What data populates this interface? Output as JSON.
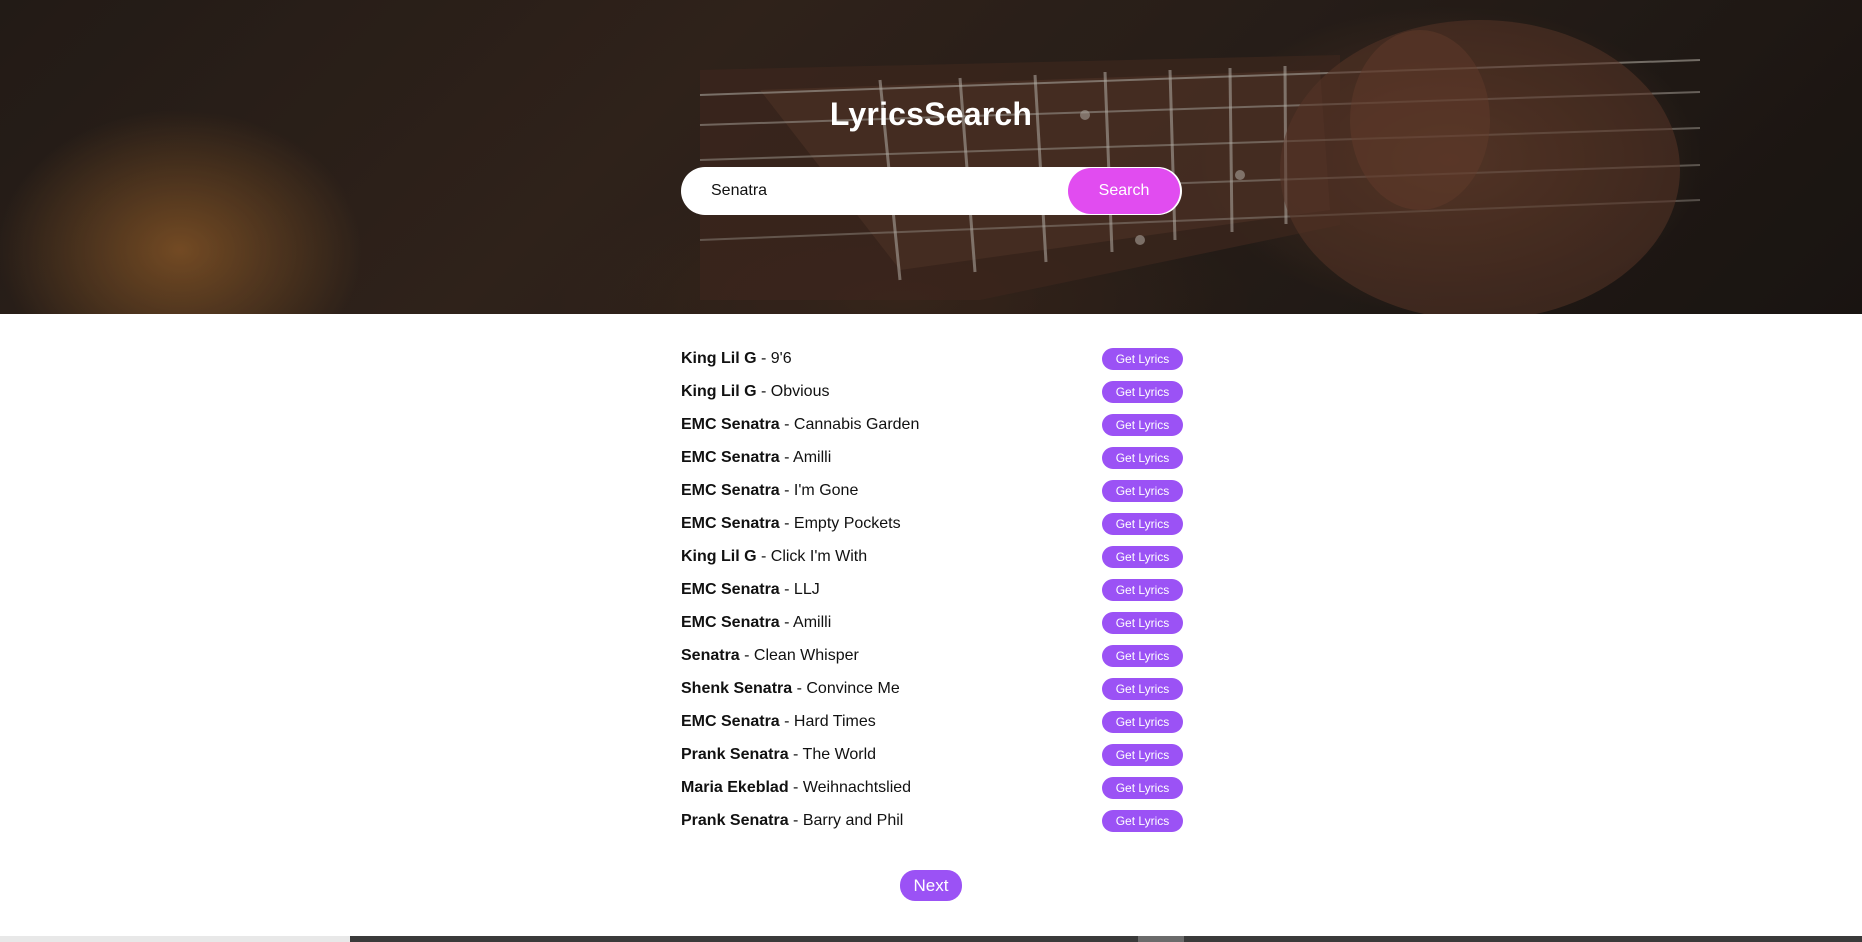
{
  "app": {
    "title": "LyricsSearch"
  },
  "search": {
    "value": "Senatra",
    "button_label": "Search"
  },
  "results": [
    {
      "artist": "King Lil G",
      "title": "9'6",
      "button_label": "Get Lyrics"
    },
    {
      "artist": "King Lil G",
      "title": "Obvious",
      "button_label": "Get Lyrics"
    },
    {
      "artist": "EMC Senatra",
      "title": "Cannabis Garden",
      "button_label": "Get Lyrics"
    },
    {
      "artist": "EMC Senatra",
      "title": "Amilli",
      "button_label": "Get Lyrics"
    },
    {
      "artist": "EMC Senatra",
      "title": "I'm Gone",
      "button_label": "Get Lyrics"
    },
    {
      "artist": "EMC Senatra",
      "title": "Empty Pockets",
      "button_label": "Get Lyrics"
    },
    {
      "artist": "King Lil G",
      "title": "Click I'm With",
      "button_label": "Get Lyrics"
    },
    {
      "artist": "EMC Senatra",
      "title": "LLJ",
      "button_label": "Get Lyrics"
    },
    {
      "artist": "EMC Senatra",
      "title": "Amilli",
      "button_label": "Get Lyrics"
    },
    {
      "artist": "Senatra",
      "title": "Clean Whisper",
      "button_label": "Get Lyrics"
    },
    {
      "artist": "Shenk Senatra",
      "title": "Convince Me",
      "button_label": "Get Lyrics"
    },
    {
      "artist": "EMC Senatra",
      "title": "Hard Times",
      "button_label": "Get Lyrics"
    },
    {
      "artist": "Prank Senatra",
      "title": "The World",
      "button_label": "Get Lyrics"
    },
    {
      "artist": "Maria Ekeblad",
      "title": "Weihnachtslied",
      "button_label": "Get Lyrics"
    },
    {
      "artist": "Prank Senatra",
      "title": "Barry and Phil",
      "button_label": "Get Lyrics"
    }
  ],
  "pagination": {
    "next_label": "Next"
  },
  "separator": " - ",
  "colors": {
    "search_button": "#e14cf0",
    "accent_button": "#9b52f5",
    "hero_dark": "#2a211c"
  },
  "hero": {
    "image": "guitar-fretboard-photo"
  }
}
